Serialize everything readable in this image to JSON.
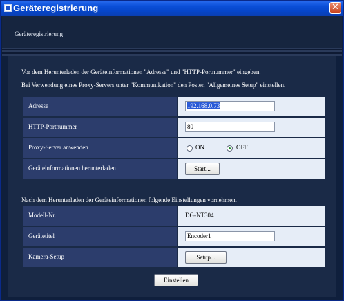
{
  "window": {
    "title": "Geräteregistrierung"
  },
  "header": {
    "title": "Geräteregistrierung"
  },
  "intro": {
    "line1": "Vor dem Herunterladen der Geräteinformationen \"Adresse\" und \"HTTP-Portnummer\" eingeben.",
    "line2": "Bei Verwendung eines Proxy-Servers unter \"Kommunikation\" den Posten \"Allgemeines Setup\" einstellen.",
    "line3": "Nach dem Herunterladen der Geräteinformationen folgende Einstellungen vornehmen."
  },
  "form": {
    "address": {
      "label": "Adresse",
      "value": "192.168.0.73"
    },
    "http_port": {
      "label": "HTTP-Portnummer",
      "value": "80"
    },
    "proxy": {
      "label": "Proxy-Server anwenden",
      "on_label": "ON",
      "off_label": "OFF",
      "selected": "OFF"
    },
    "download": {
      "label": "Geräteinformationen herunterladen",
      "button_label": "Start..."
    },
    "model": {
      "label": "Modell-Nr.",
      "value": "DG-NT304"
    },
    "device_title": {
      "label": "Gerätetitel",
      "value": "Encoder1"
    },
    "camera_setup": {
      "label": "Kamera-Setup",
      "button_label": "Setup..."
    }
  },
  "footer": {
    "apply_label": "Einstellen"
  },
  "colors": {
    "titlebar": "#0645c8",
    "panel": "#1a2a47",
    "label_cell": "#2c3d6c",
    "value_cell": "#e6edf7"
  }
}
